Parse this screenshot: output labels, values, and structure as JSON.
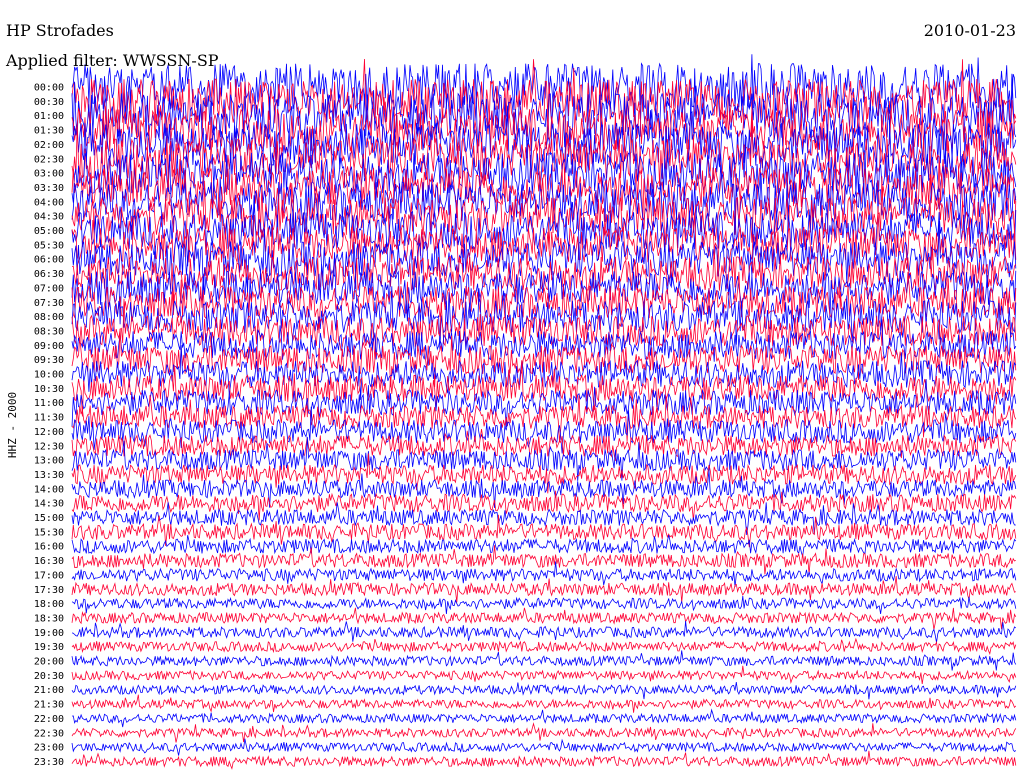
{
  "chart_data": {
    "type": "line",
    "subtype": "helicorder",
    "station": "HP Strofades",
    "date": "2010-01-23",
    "filter_label": "Applied filter: WWSSN-SP",
    "channel_label": "HHZ - 2000",
    "row_labels": [
      "00:00",
      "00:30",
      "01:00",
      "01:30",
      "02:00",
      "02:30",
      "03:00",
      "03:30",
      "04:00",
      "04:30",
      "05:00",
      "05:30",
      "06:00",
      "06:30",
      "07:00",
      "07:30",
      "08:00",
      "08:30",
      "09:00",
      "09:30",
      "10:00",
      "10:30",
      "11:00",
      "11:30",
      "12:00",
      "12:30",
      "13:00",
      "13:30",
      "14:00",
      "14:30",
      "15:00",
      "15:30",
      "16:00",
      "16:30",
      "17:00",
      "17:30",
      "18:00",
      "18:30",
      "19:00",
      "19:30",
      "20:00",
      "20:30",
      "21:00",
      "21:30",
      "22:00",
      "22:30",
      "23:00",
      "23:30"
    ],
    "row_duration_minutes": 30,
    "trace_colors": [
      "#0000ff",
      "#ff0033"
    ],
    "relative_amplitude_by_row": [
      2.6,
      2.5,
      2.5,
      2.4,
      2.4,
      2.3,
      2.3,
      2.2,
      2.2,
      2.1,
      2.1,
      2.0,
      2.0,
      1.9,
      1.9,
      1.8,
      1.8,
      1.7,
      1.6,
      1.6,
      1.5,
      1.5,
      1.4,
      1.3,
      1.3,
      1.2,
      1.2,
      1.1,
      1.0,
      1.0,
      0.9,
      0.9,
      0.8,
      0.8,
      0.7,
      0.7,
      0.6,
      0.6,
      0.6,
      0.55,
      0.55,
      0.5,
      0.5,
      0.5,
      0.5,
      0.5,
      0.5,
      0.55
    ],
    "grid": false
  }
}
